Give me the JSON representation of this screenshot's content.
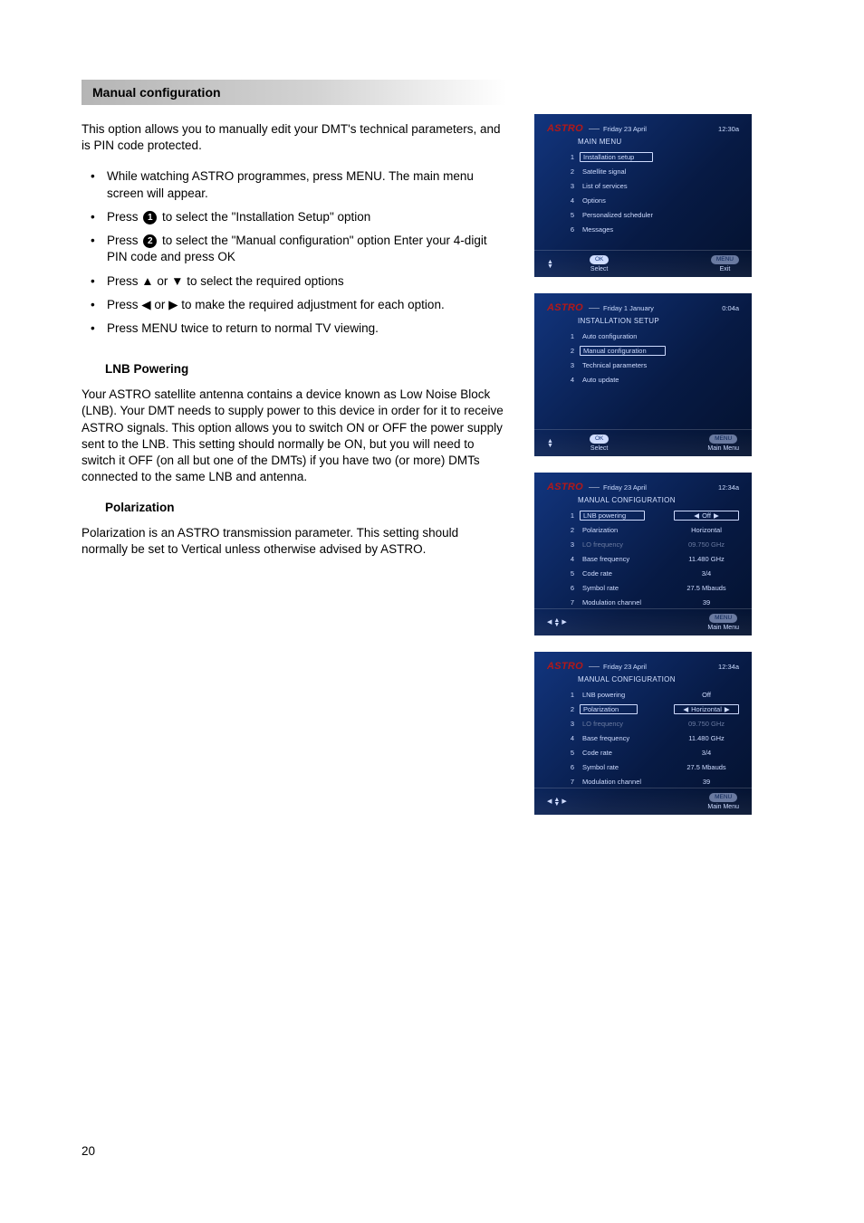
{
  "section_header": "Manual configuration",
  "intro": "This option allows you to manually edit your DMT's technical parameters, and is PIN code protected.",
  "steps": [
    {
      "text": "While watching ASTRO programmes, press MENU. The main menu screen will appear."
    },
    {
      "pre": "Press ",
      "disc": "1",
      "post": " to select the \"Installation Setup\" option"
    },
    {
      "pre": "Press ",
      "disc": "2",
      "post": " to select the \"Manual configuration\" option Enter your 4-digit PIN code and press OK"
    },
    {
      "text": "Press ▲ or ▼ to select the required options"
    },
    {
      "text": "Press ◀ or ▶ to make the required adjustment for each option."
    },
    {
      "text": "Press MENU twice to return to normal TV viewing."
    }
  ],
  "lnb_heading": "LNB Powering",
  "lnb_para": "Your ASTRO satellite antenna contains a device known as Low Noise Block (LNB).  Your DMT needs to supply power to this device in order for it to receive ASTRO signals.  This option allows you to switch ON or OFF the power supply sent to the LNB.   This setting should normally be ON, but you will need to switch it OFF (on all but one of the DMTs) if you have two (or more) DMTs connected to the same LNB and antenna.",
  "pol_heading": "Polarization",
  "pol_para": "Polarization is an ASTRO transmission parameter. This setting should normally be set to Vertical unless otherwise advised by ASTRO.",
  "page_number": "20",
  "tv_logo": "ASTRO",
  "screens": {
    "main_menu": {
      "date": "Friday 23 April",
      "time": "12:30a",
      "title": "MAIN MENU",
      "items": [
        "Installation setup",
        "Satellite signal",
        "List of services",
        "Options",
        "Personalized scheduler",
        "Messages"
      ],
      "foot_left": "▲\n▼",
      "foot_ok": "OK",
      "foot_ok_label": "Select",
      "foot_right": "MENU",
      "foot_right_label": "Exit"
    },
    "install_setup": {
      "date": "Friday 1 January",
      "time": "0:04a",
      "title": "INSTALLATION SETUP",
      "items": [
        "Auto configuration",
        "Manual configuration",
        "Technical parameters",
        "Auto update"
      ],
      "foot_left": "▲\n▼",
      "foot_ok": "OK",
      "foot_ok_label": "Select",
      "foot_right": "MENU",
      "foot_right_label": "Main Menu"
    },
    "manual_cfg_a": {
      "date": "Friday 23 April",
      "time": "12:34a",
      "title": "MANUAL CONFIGURATION",
      "rows": [
        {
          "num": "1",
          "label": "LNB powering",
          "val": "Off",
          "boxedLabel": true,
          "valArrows": true
        },
        {
          "num": "2",
          "label": "Polarization",
          "val": "Horizontal"
        },
        {
          "num": "3",
          "label": "LO frequency",
          "val": "09.750  GHz",
          "dim": true
        },
        {
          "num": "4",
          "label": "Base frequency",
          "val": "11.480  GHz"
        },
        {
          "num": "5",
          "label": "Code rate",
          "val": "3/4"
        },
        {
          "num": "6",
          "label": "Symbol rate",
          "val": "27.5  Mbauds"
        },
        {
          "num": "7",
          "label": "Modulation channel",
          "val": "39"
        }
      ],
      "foot_left": "◀ ▲▼ ▶",
      "foot_right": "MENU",
      "foot_right_label": "Main Menu"
    },
    "manual_cfg_b": {
      "date": "Friday 23 April",
      "time": "12:34a",
      "title": "MANUAL CONFIGURATION",
      "rows": [
        {
          "num": "1",
          "label": "LNB powering",
          "val": "Off"
        },
        {
          "num": "2",
          "label": "Polarization",
          "val": "Horizontal",
          "boxedLabel": true,
          "valArrows": true
        },
        {
          "num": "3",
          "label": "LO frequency",
          "val": "09.750  GHz",
          "dim": true
        },
        {
          "num": "4",
          "label": "Base frequency",
          "val": "11.480  GHz"
        },
        {
          "num": "5",
          "label": "Code rate",
          "val": "3/4"
        },
        {
          "num": "6",
          "label": "Symbol rate",
          "val": "27.5  Mbauds"
        },
        {
          "num": "7",
          "label": "Modulation channel",
          "val": "39"
        }
      ],
      "foot_left": "◀ ▲▼ ▶",
      "foot_right": "MENU",
      "foot_right_label": "Main Menu"
    }
  }
}
